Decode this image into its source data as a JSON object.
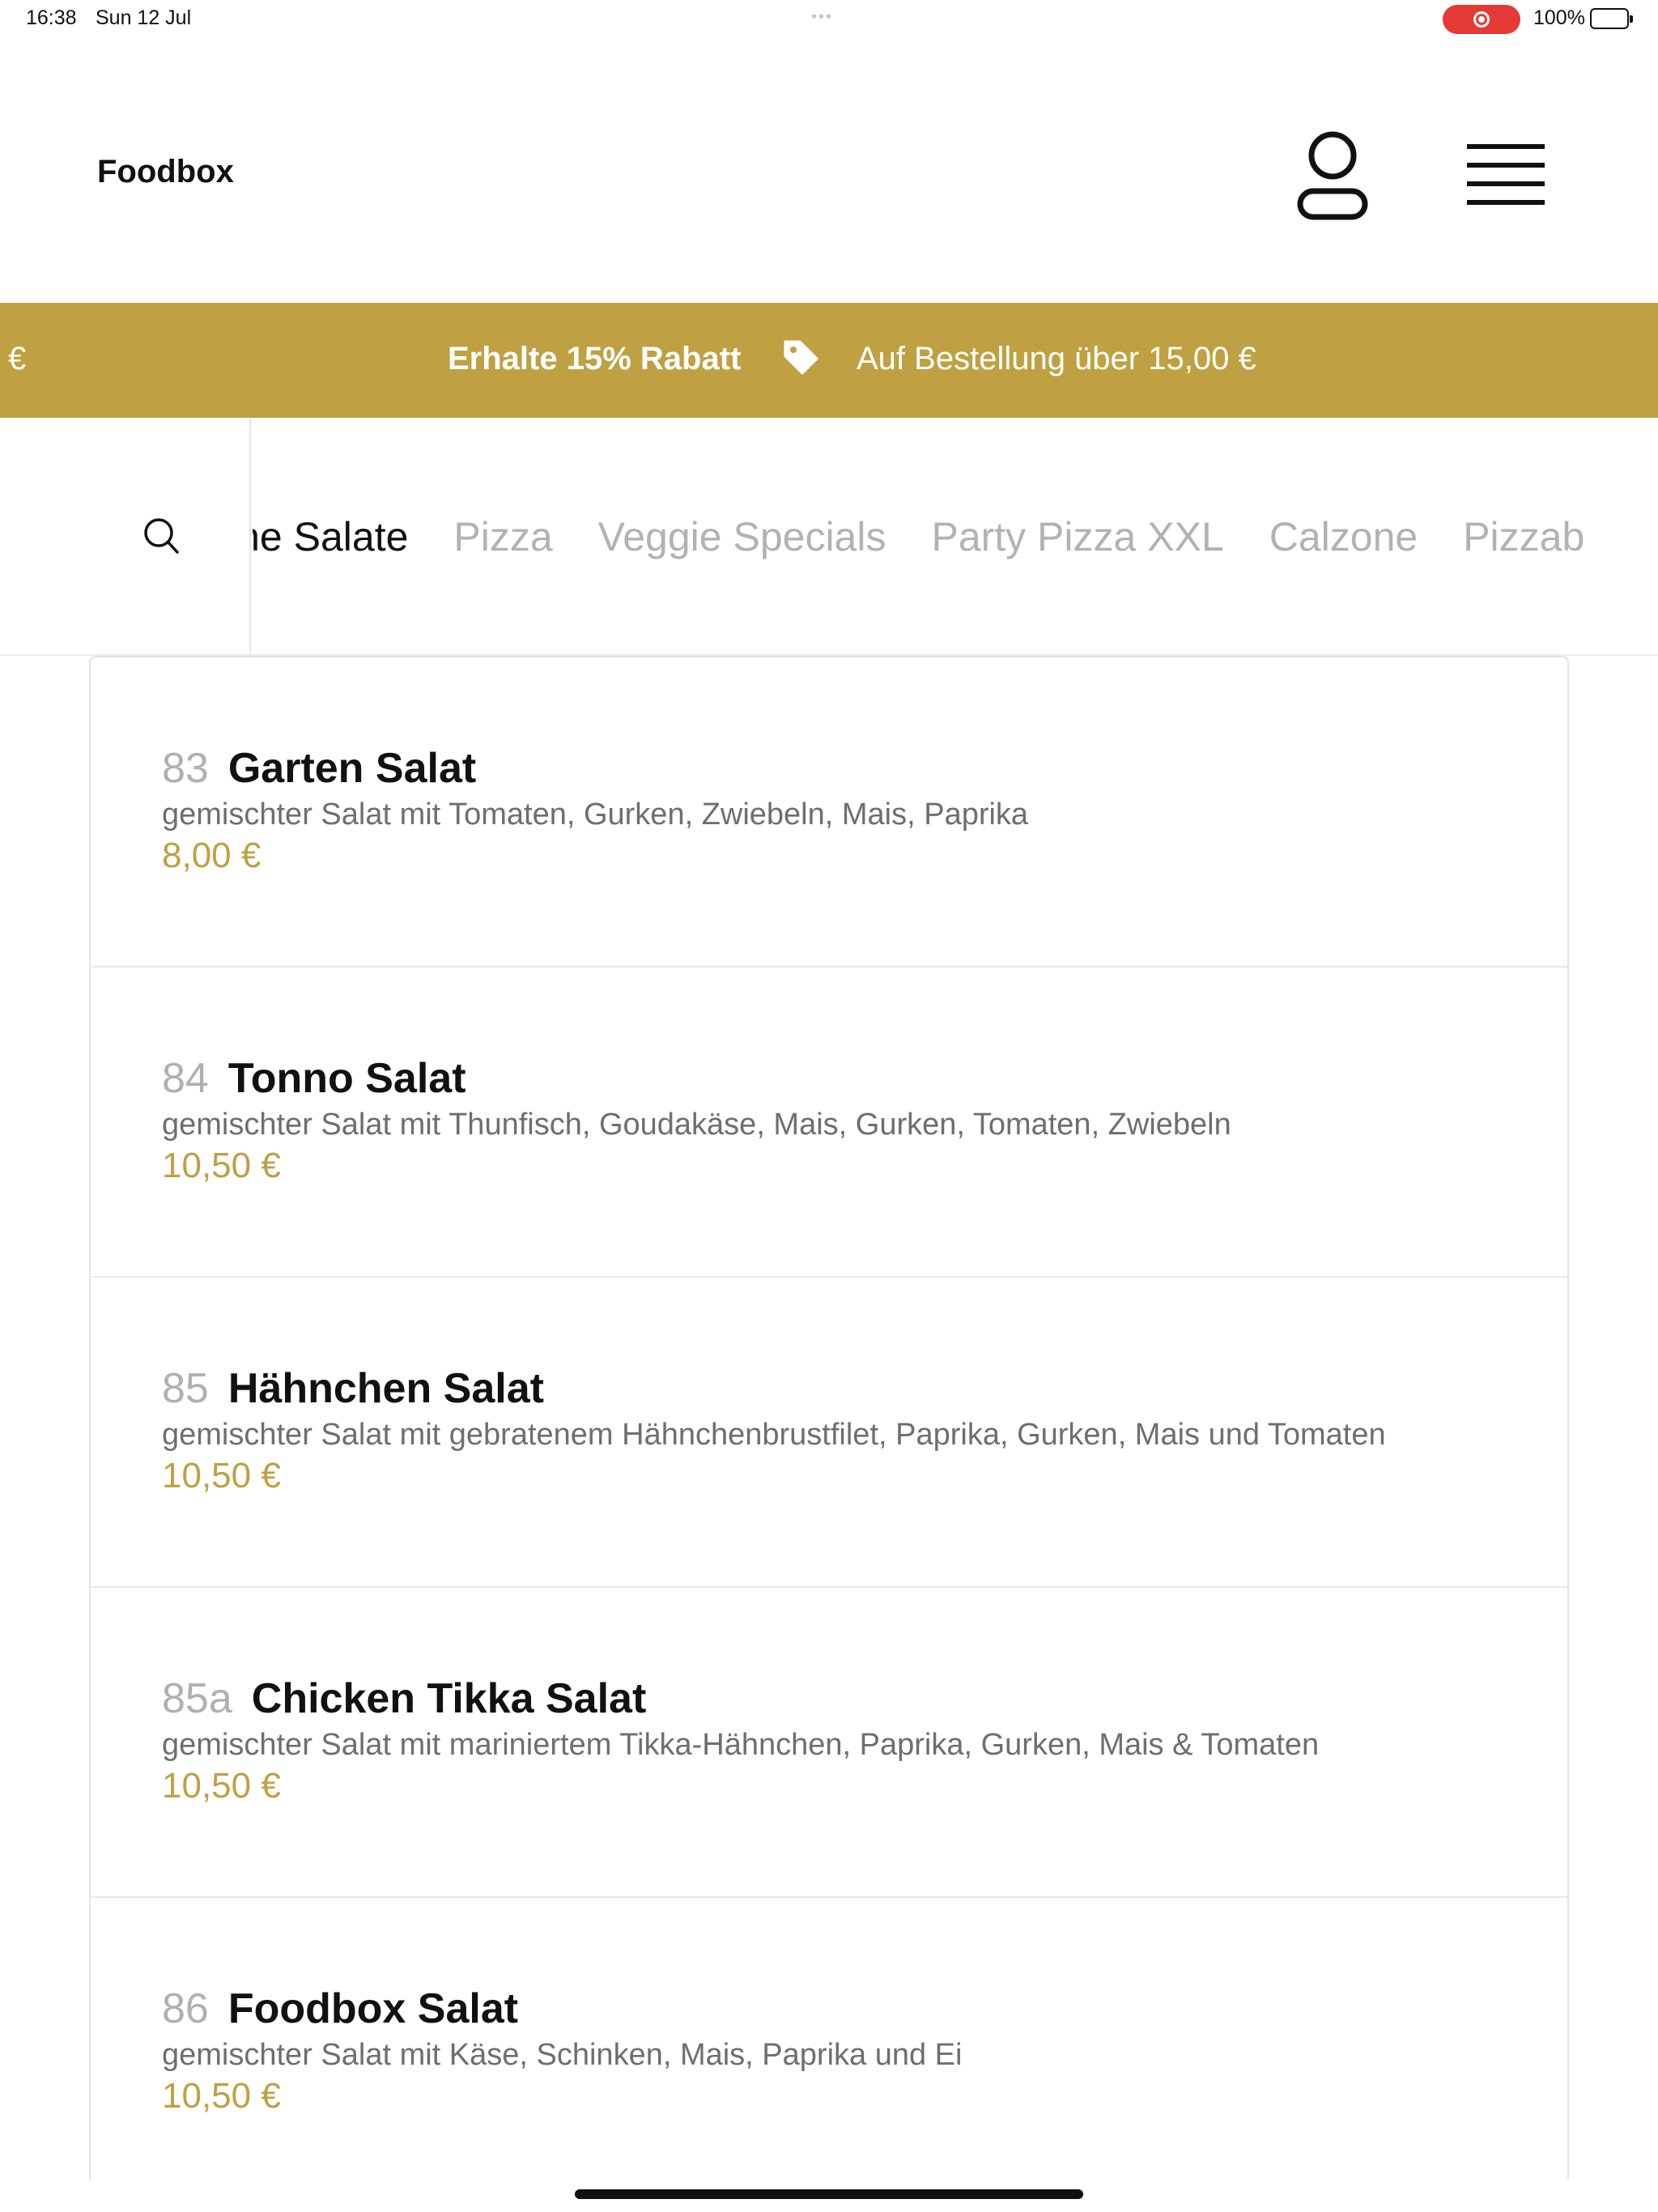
{
  "status_bar": {
    "time": "16:38",
    "date": "Sun 12 Jul",
    "battery": "100%"
  },
  "header": {
    "brand": "Foodbox"
  },
  "promo": {
    "edge_text": "€",
    "headline": "Erhalte 15% Rabatt",
    "detail": "Auf Bestellung über 15,00 €"
  },
  "categories": [
    "ische Salate",
    "Pizza",
    "Veggie Specials",
    "Party Pizza XXL",
    "Calzone",
    "Pizzab"
  ],
  "active_category_index": 0,
  "products": [
    {
      "number": "83",
      "name": "Garten Salat",
      "description": "gemischter Salat mit Tomaten, Gurken, Zwiebeln, Mais, Paprika",
      "price": "8,00 €"
    },
    {
      "number": "84",
      "name": "Tonno Salat",
      "description": "gemischter Salat mit Thunfisch, Goudakäse, Mais, Gurken, Tomaten, Zwiebeln",
      "price": "10,50 €"
    },
    {
      "number": "85",
      "name": "Hähnchen Salat",
      "description": "gemischter Salat mit gebratenem Hähnchenbrustfilet, Paprika, Gurken, Mais und Tomaten",
      "price": "10,50 €"
    },
    {
      "number": "85a",
      "name": "Chicken Tikka Salat",
      "description": "gemischter Salat mit mariniertem Tikka-Hähnchen, Paprika, Gurken, Mais & Tomaten",
      "price": "10,50 €"
    },
    {
      "number": "86",
      "name": "Foodbox Salat",
      "description": "gemischter Salat mit Käse, Schinken, Mais, Paprika und Ei",
      "price": "10,50 €"
    }
  ],
  "icons": {
    "user": "user-icon",
    "menu": "hamburger-menu-icon",
    "search": "search-icon",
    "tag": "price-tag-icon"
  },
  "colors": {
    "accent": "#bfa143",
    "muted_text": "#6e6e6e",
    "inactive_tab": "#b2b2b2"
  }
}
